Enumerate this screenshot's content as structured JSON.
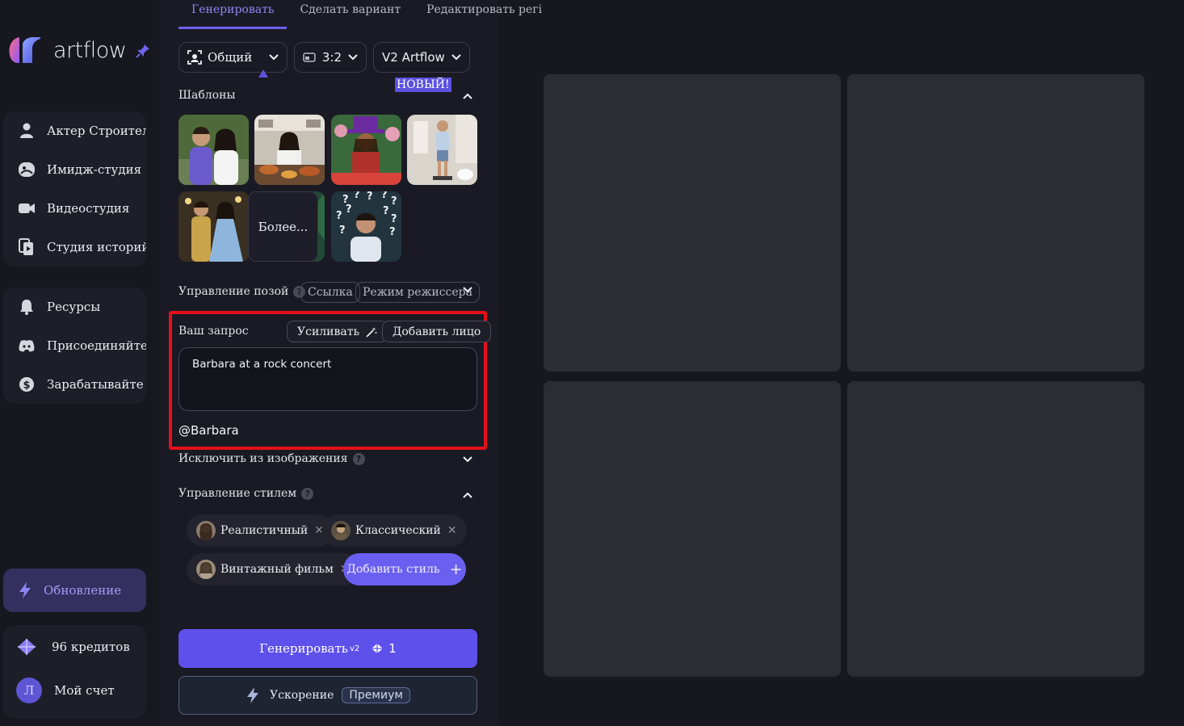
{
  "brand": {
    "name": "artflow"
  },
  "sidebar": {
    "group1": [
      {
        "label": "Актер Строител",
        "icon": "user-icon"
      },
      {
        "label": "Имидж-студия",
        "icon": "image-studio-icon"
      },
      {
        "label": "Видеостудия",
        "icon": "video-camera-icon"
      },
      {
        "label": "Студия историй",
        "icon": "story-icon"
      }
    ],
    "group2": [
      {
        "label": "Ресурсы",
        "icon": "bell-icon"
      },
      {
        "label": "Присоединяйте",
        "icon": "discord-icon"
      },
      {
        "label": "Зарабатывайте д",
        "icon": "dollar-icon"
      }
    ],
    "upgrade": "Обновление",
    "credits": "96 кредитов",
    "account_label": "Мой счет",
    "avatar_letter": "Л"
  },
  "tabs": [
    "Генерировать",
    "Сделать вариант",
    "Редактировать регі"
  ],
  "controls": {
    "mode": "Общий",
    "ratio": "3:2",
    "model": "V2 Artflow",
    "new_badge": "НОВЫЙ!"
  },
  "templates": {
    "title": "Шаблоны",
    "more": "Более..."
  },
  "pose": {
    "title": "Управление позой",
    "link": "Ссылка",
    "director": "Режим режиссера"
  },
  "prompt": {
    "title": "Ваш запрос",
    "enhance": "Усиливать",
    "add_face": "Добавить лицо",
    "text": "Barbara at a rock concert",
    "mention": "@Barbara"
  },
  "exclude": {
    "title": "Исключить из изображения"
  },
  "style": {
    "title": "Управление стилем",
    "chips": [
      "Реалистичный",
      "Классический",
      "Винтажный фильм"
    ],
    "add": "Добавить стиль"
  },
  "actions": {
    "generate": "Генерировать",
    "generate_sup": "v2",
    "generate_cost": "1",
    "boost": "Ускорение",
    "premium": "Премиум"
  },
  "colors": {
    "accent": "#5e50ea",
    "highlight": "#e5101a",
    "background": "#17171f"
  }
}
